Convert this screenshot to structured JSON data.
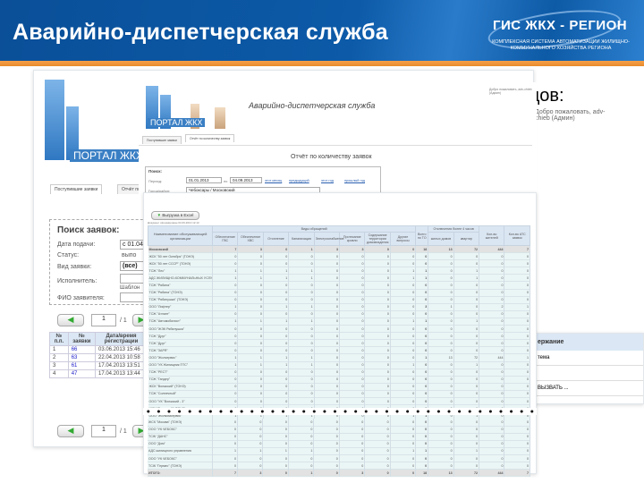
{
  "slide": {
    "title": "Аварийно-диспетчерская служба",
    "obscured_text": "цов:"
  },
  "logo": {
    "name": "ГИС ЖКХ - РЕГИОН",
    "subtitle": "КОМПЛЕКСНАЯ СИСТЕМА АВТОМАТИЗАЦИИ ЖИЛИЩНО-КОММУНАЛЬНОГО ХОЗЯЙСТВА РЕГИОНА"
  },
  "colors": {
    "header": "#0c5aa8",
    "accent": "#e88a2b"
  },
  "back_screen": {
    "portal_label": "ПОРТАЛ ЖКХ",
    "welcome": "Добро пожаловать, adv-chieb (Админ)",
    "tabs": [
      "Поступившие заявки",
      "Отчёт по"
    ],
    "search_title": "Поиск заявок:",
    "fields": [
      {
        "label": "Дата подачи:",
        "value": "с 01.04"
      },
      {
        "label": "Статус:",
        "value": "выпо"
      },
      {
        "label": "Вид заявки:",
        "value": "(все)"
      },
      {
        "label": "Исполнитель:",
        "value": "",
        "hint": "Шаблон"
      },
      {
        "label": "ФИО заявителя:",
        "value": ""
      }
    ],
    "pager": {
      "page": "1",
      "total": "/ 1"
    },
    "columns": [
      "№ п.п.",
      "№ заявки",
      "Дата/время регистрации"
    ],
    "rows": [
      [
        "1",
        "66",
        "03.06.2013 15:46"
      ],
      [
        "2",
        "63",
        "22.04.2013 10:58"
      ],
      [
        "3",
        "61",
        "17.04.2013 13:51"
      ],
      [
        "4",
        "47",
        "17.04.2013 13:44"
      ]
    ],
    "right_col_header": "ержание",
    "right_rows": [
      "тема",
      "",
      "ВЫЗВАТЬ ...",
      ""
    ]
  },
  "middle_screen": {
    "portal_label": "ПОРТАЛ ЖКХ",
    "app_title": "Аварийно-диспетчерская служба",
    "welcome": "Добро пожаловать, adv-chieb (Админ)",
    "tabs": [
      "Поступившие заявки",
      "Отчёт по количеству заявок"
    ],
    "report_title": "Отчёт по количеству заявок",
    "search": {
      "title": "Поиск:",
      "period_label": "Период:",
      "from": "01.01.2013",
      "to_label": "по",
      "to": "04.09.2013",
      "quick_links": [
        "этот месяц",
        "предыдущий",
        "этот год",
        "прошлый год"
      ],
      "district_label": "Город/район:",
      "district": "Чебоксары / Московский"
    },
    "subtitle": "Отчёт по количеству заявок с 1 января 2013 г. по 4 сентября 2013 г.",
    "export_button": "Выгрузка в Excel",
    "generated": "Документ сформирован 04.09.2013 12:13"
  },
  "report_table": {
    "org_header": "Наименование обслуживающей организации",
    "group_header": "Виды обращений",
    "types": [
      "Обеспечение ГВС",
      "Обеспечение ХВС",
      "Отопление",
      "Канализация",
      "Электроснабжение",
      "Протекание кровли",
      "Содержание территории домовладения",
      "Другие вопросы"
    ],
    "total_header": "Всего по ТО",
    "outage_header": "Отключения более 4 часов",
    "outage_cols": [
      "жилых домов",
      "квартир"
    ],
    "residents_header": "Кол-во жителей",
    "ats_header": "Кол-во АТС заявок",
    "rows": [
      {
        "name": "Московский",
        "v": [
          "7",
          "3",
          "0",
          "1",
          "3",
          "3",
          "0",
          "0",
          "18",
          "13",
          "72",
          "444",
          "7"
        ],
        "total": true
      },
      {
        "name": "ЖСК \"50 лет Октября\" (ТОНЭ)",
        "v": [
          "0",
          "0",
          "0",
          "0",
          "0",
          "0",
          "0",
          "0",
          "0",
          "0",
          "0",
          "0",
          "0"
        ]
      },
      {
        "name": "ЖСК \"50 лет СССР\" (ТОНЭ)",
        "v": [
          "0",
          "0",
          "0",
          "0",
          "0",
          "0",
          "0",
          "0",
          "0",
          "0",
          "0",
          "0",
          "0"
        ]
      },
      {
        "name": "ТСЖ \"Лес\"",
        "v": [
          "1",
          "1",
          "1",
          "1",
          "0",
          "0",
          "0",
          "1",
          "1",
          "0",
          "1",
          "0",
          "0"
        ]
      },
      {
        "name": "АДС ЖИЛИЩНО-КОММУНАЛЬНЫХ УСЛУГ",
        "v": [
          "1",
          "1",
          "1",
          "1",
          "0",
          "0",
          "0",
          "1",
          "1",
          "0",
          "1",
          "0",
          "0"
        ]
      },
      {
        "name": "ТСЖ \"Рябина\"",
        "v": [
          "0",
          "0",
          "0",
          "0",
          "0",
          "0",
          "0",
          "0",
          "0",
          "0",
          "0",
          "0",
          "0"
        ]
      },
      {
        "name": "ТСЖ \"Рябина\" (ТОНЭ)",
        "v": [
          "0",
          "0",
          "0",
          "0",
          "0",
          "0",
          "0",
          "0",
          "0",
          "0",
          "0",
          "0",
          "0"
        ]
      },
      {
        "name": "ТСЖ \"Рябинушка\" (ТОНЭ)",
        "v": [
          "0",
          "0",
          "0",
          "0",
          "0",
          "0",
          "0",
          "0",
          "0",
          "0",
          "0",
          "0",
          "0"
        ]
      },
      {
        "name": "ООО \"Лифтер\"",
        "v": [
          "1",
          "0",
          "1",
          "1",
          "0",
          "0",
          "0",
          "0",
          "3",
          "1",
          "0",
          "2",
          "1"
        ]
      },
      {
        "name": "ТСЖ \"Атлант\"",
        "v": [
          "0",
          "0",
          "0",
          "0",
          "0",
          "0",
          "0",
          "0",
          "0",
          "0",
          "0",
          "0",
          "0"
        ]
      },
      {
        "name": "ТСЖ \"Автомобилист\"",
        "v": [
          "1",
          "1",
          "1",
          "1",
          "0",
          "0",
          "0",
          "1",
          "1",
          "0",
          "1",
          "0",
          "0"
        ]
      },
      {
        "name": "ООО \"ЖЭК Рябинушка\"",
        "v": [
          "0",
          "0",
          "0",
          "0",
          "0",
          "0",
          "0",
          "0",
          "0",
          "0",
          "0",
          "0",
          "0"
        ]
      },
      {
        "name": "ТСЖ \"Друг\"",
        "v": [
          "0",
          "0",
          "0",
          "0",
          "0",
          "0",
          "0",
          "0",
          "0",
          "0",
          "0",
          "0",
          "0"
        ]
      },
      {
        "name": "ТСЖ \"Друг\"",
        "v": [
          "0",
          "0",
          "0",
          "0",
          "0",
          "0",
          "0",
          "0",
          "0",
          "0",
          "0",
          "0",
          "0"
        ]
      },
      {
        "name": "ТСЖ \"ЗАРЯ\"",
        "v": [
          "0",
          "0",
          "0",
          "0",
          "0",
          "0",
          "0",
          "0",
          "0",
          "0",
          "0",
          "0",
          "0"
        ]
      },
      {
        "name": "ООО \"Жилсервис\"",
        "v": [
          "1",
          "1",
          "1",
          "1",
          "0",
          "0",
          "0",
          "0",
          "1",
          "13",
          "72",
          "444",
          "1"
        ]
      },
      {
        "name": "ООО \"УК Жилищник ПТС\"",
        "v": [
          "1",
          "1",
          "1",
          "1",
          "0",
          "0",
          "0",
          "1",
          "0",
          "0",
          "1",
          "0",
          "0"
        ]
      },
      {
        "name": "ТСЖ \"РЕСТ\"",
        "v": [
          "0",
          "0",
          "0",
          "0",
          "0",
          "0",
          "0",
          "0",
          "0",
          "0",
          "0",
          "0",
          "0"
        ]
      },
      {
        "name": "ТСЖ \"Гандер\"",
        "v": [
          "0",
          "0",
          "0",
          "0",
          "0",
          "0",
          "0",
          "0",
          "0",
          "0",
          "0",
          "0",
          "0"
        ]
      },
      {
        "name": "ЖСК \"Волжский\" (ТОНЭ)",
        "v": [
          "0",
          "0",
          "0",
          "0",
          "0",
          "0",
          "0",
          "0",
          "0",
          "0",
          "0",
          "0",
          "0"
        ]
      },
      {
        "name": "ТСЖ \"Солнечный\"",
        "v": [
          "0",
          "0",
          "0",
          "0",
          "0",
          "0",
          "0",
          "0",
          "0",
          "0",
          "0",
          "0",
          "0"
        ]
      },
      {
        "name": "ООО \"УК \"Волжский - 3\"",
        "v": [
          "0",
          "0",
          "0",
          "0",
          "0",
          "0",
          "0",
          "0",
          "0",
          "0",
          "0",
          "0",
          "0"
        ]
      },
      {
        "name": "ЖСК \"Волжский\" (ТОНЭ)",
        "v": [
          "0",
          "0",
          "0",
          "0",
          "0",
          "0",
          "0",
          "0",
          "0",
          "0",
          "0",
          "0",
          "0"
        ]
      },
      {
        "name": "ООО \"Жилкомсервис\"",
        "v": [
          "1",
          "1",
          "1",
          "1",
          "0",
          "0",
          "0",
          "1",
          "1",
          "0",
          "1",
          "0",
          "0"
        ]
      }
    ],
    "rows_after": [
      {
        "name": "ЖСК \"Москва\" (ТОНЭ)",
        "v": [
          "0",
          "0",
          "0",
          "0",
          "0",
          "0",
          "0",
          "0",
          "0",
          "0",
          "0",
          "0",
          "0"
        ]
      },
      {
        "name": "ООО \"УК ЧЕБОКС\"",
        "v": [
          "0",
          "0",
          "0",
          "0",
          "0",
          "0",
          "0",
          "0",
          "0",
          "0",
          "0",
          "0",
          "0"
        ]
      },
      {
        "name": "ТСЖ \"ДАНС\"",
        "v": [
          "0",
          "0",
          "0",
          "0",
          "0",
          "0",
          "0",
          "0",
          "0",
          "0",
          "0",
          "0",
          "0"
        ]
      },
      {
        "name": "ООО \"Дом\"",
        "v": [
          "0",
          "0",
          "0",
          "0",
          "0",
          "0",
          "0",
          "0",
          "0",
          "0",
          "0",
          "0",
          "0"
        ]
      },
      {
        "name": "АДС жилищного управления",
        "v": [
          "1",
          "1",
          "1",
          "1",
          "0",
          "0",
          "0",
          "1",
          "1",
          "0",
          "1",
          "0",
          "0"
        ]
      },
      {
        "name": "ООО \"УК ЧЕБОКС\"",
        "v": [
          "0",
          "0",
          "0",
          "0",
          "0",
          "0",
          "0",
          "0",
          "0",
          "0",
          "0",
          "0",
          "0"
        ]
      },
      {
        "name": "ТСЖ \"Гермес\" (ТОНЭ)",
        "v": [
          "0",
          "0",
          "0",
          "0",
          "0",
          "0",
          "0",
          "0",
          "0",
          "0",
          "0",
          "0",
          "0"
        ]
      },
      {
        "name": "ИТОГО:",
        "v": [
          "7",
          "3",
          "0",
          "1",
          "0",
          "3",
          "0",
          "0",
          "18",
          "13",
          "72",
          "444",
          "7"
        ],
        "total": true
      }
    ]
  }
}
